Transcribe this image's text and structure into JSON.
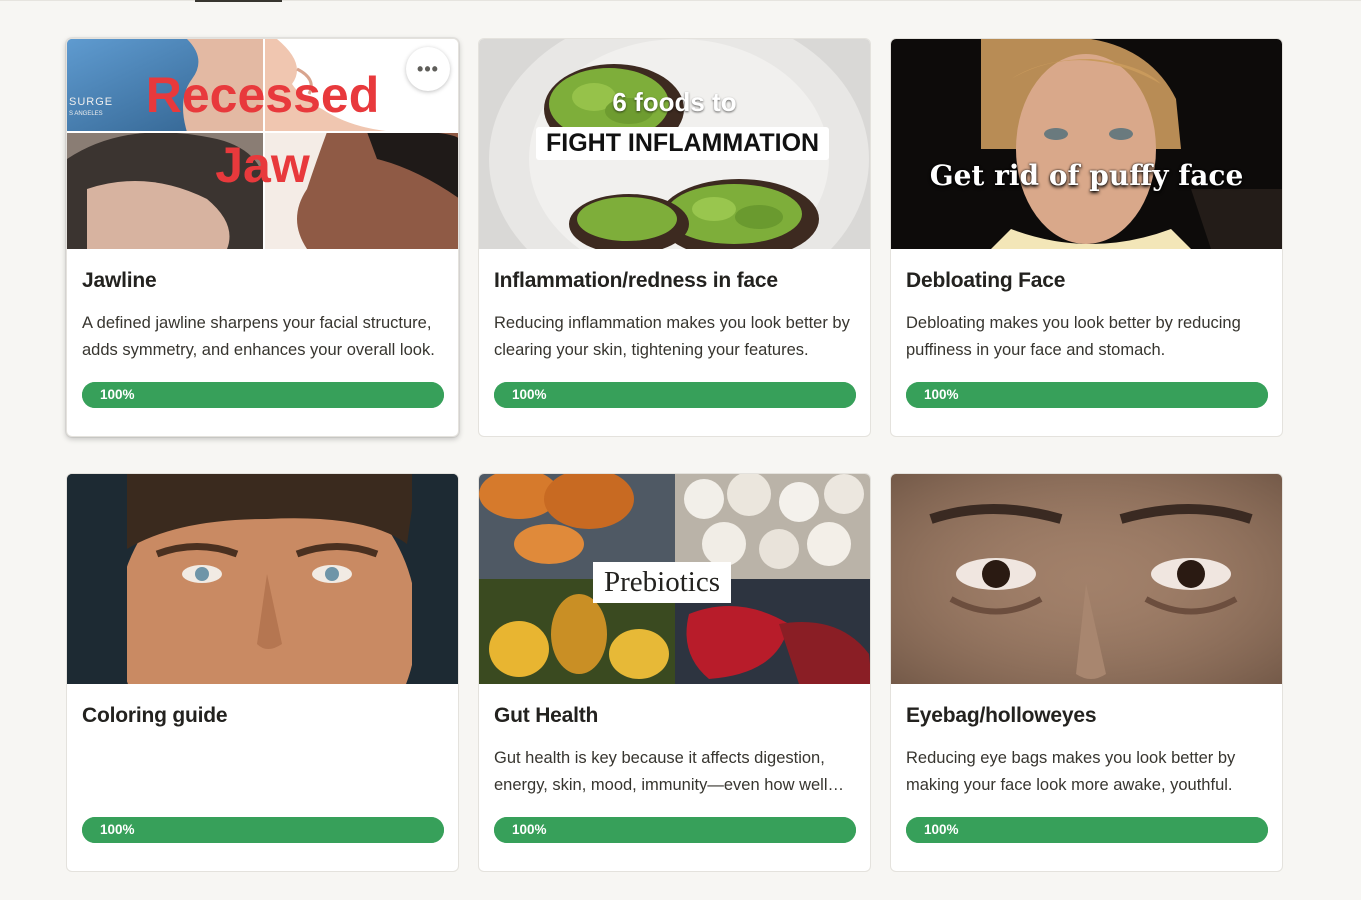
{
  "cards": [
    {
      "title": "Jawline",
      "description": "A defined jawline sharpens your facial structure, adds symmetry, and enhances your overall look.",
      "progress_label": "100%",
      "progress_value": 1.0,
      "cover_text": [
        "Recessed",
        "Jaw"
      ],
      "cover_watermark": [
        "SURGE",
        "S ANGELES"
      ],
      "more_button": "•••"
    },
    {
      "title": "Inflammation/redness in face",
      "description": "Reducing inflammation makes you look better by clearing your skin, tightening your features.",
      "progress_label": "100%",
      "progress_value": 1.0,
      "cover_text": [
        "6 foods to",
        "FIGHT INFLAMMATION"
      ]
    },
    {
      "title": "Debloating Face",
      "description": "Debloating makes you look better by reducing puffiness in your face and stomach.",
      "progress_label": "100%",
      "progress_value": 1.0,
      "cover_text": [
        "Get rid of puffy face"
      ]
    },
    {
      "title": "Coloring guide",
      "description": "",
      "progress_label": "100%",
      "progress_value": 1.0
    },
    {
      "title": "Gut Health",
      "description": "Gut health is key because it affects digestion, energy, skin, mood, immunity—even how well you look.",
      "progress_label": "100%",
      "progress_value": 1.0,
      "cover_text": [
        "Prebiotics"
      ]
    },
    {
      "title": "Eyebag/holloweyes",
      "description": "Reducing eye bags makes you look better by making your face look more awake, youthful.",
      "progress_label": "100%",
      "progress_value": 1.0
    }
  ],
  "colors": {
    "progress": "#37a05a",
    "page_bg": "#f7f6f3",
    "recessed_text": "#e8393c"
  }
}
